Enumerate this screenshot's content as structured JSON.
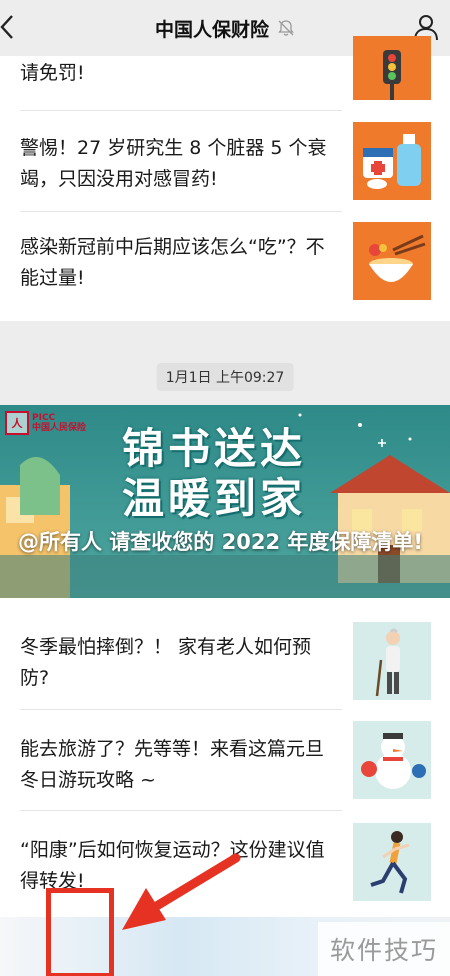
{
  "header": {
    "title": "中国人保财险"
  },
  "feed_top": {
    "items": [
      {
        "title": "请免罚!"
      },
      {
        "title": "警惕！27 岁研究生 8 个脏器 5 个衰竭，只因没用对感冒药!"
      },
      {
        "title": "感染新冠前中后期应该怎么“吃”？不能过量!"
      }
    ]
  },
  "timestamp": "1月1日 上午09:27",
  "feed_bottom": {
    "banner": {
      "logo_name": "PICC",
      "logo_subtitle": "中国人民保险",
      "headline_line1": "锦书送达",
      "headline_line2": "温暖到家",
      "caption": "@所有人 请查收您的 2022 年度保障清单!"
    },
    "items": [
      {
        "title": "冬季最怕摔倒？！ 家有老人如何预防?"
      },
      {
        "title": "能去旅游了？先等等！来看这篇元旦冬日游玩攻略 ~"
      },
      {
        "title": "“阳康”后如何恢复运动？这份建议值得转发!"
      }
    ]
  },
  "watermark": "软件技巧",
  "colors": {
    "annotation": "#e53222",
    "thumb_orange": "#f07a2c",
    "banner_teal": "#2f8f8c"
  }
}
